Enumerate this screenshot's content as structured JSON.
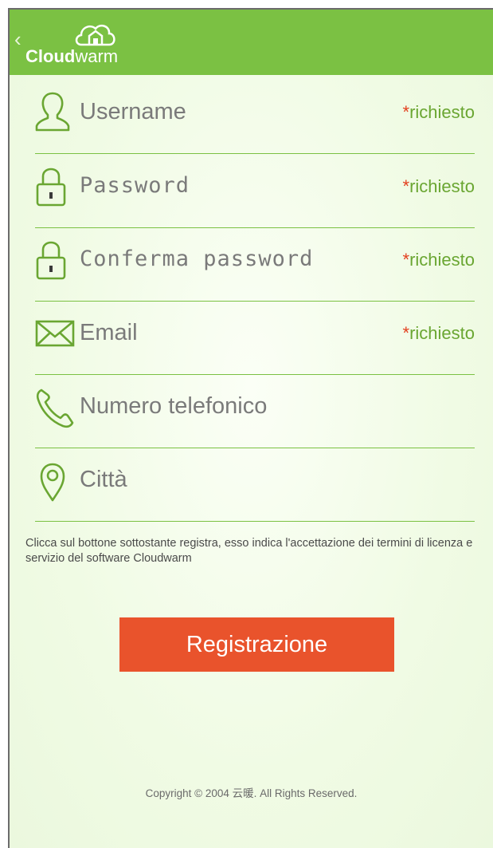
{
  "header": {
    "back_symbol": "‹",
    "logo_bold": "Cloud",
    "logo_light": "warm",
    "background": "#7bc143"
  },
  "form": {
    "fields": [
      {
        "icon": "user-icon",
        "label": "Username",
        "required": "richiesto",
        "required_star": "*"
      },
      {
        "icon": "lock-icon",
        "label": "Password",
        "required": "richiesto",
        "required_star": "*"
      },
      {
        "icon": "lock-icon",
        "label": "Conferma password",
        "required": "richiesto",
        "required_star": "*"
      },
      {
        "icon": "mail-icon",
        "label": "Email",
        "required": "richiesto",
        "required_star": "*"
      },
      {
        "icon": "phone-icon",
        "label": "Numero telefonico"
      },
      {
        "icon": "location-pin-icon",
        "label": "Città"
      }
    ]
  },
  "notice": "Clicca sul bottone sottostante registra, esso indica l'accettazione dei termini di licenza e servizio del software Cloudwarm",
  "register_button": {
    "label": "Registrazione",
    "color": "#e9532c"
  },
  "footer": {
    "copyright": "Copyright © 2004 云暖. All Rights Reserved."
  },
  "colors": {
    "accent": "#7bc143",
    "required_text": "#6aa632",
    "required_star": "#e33f1e"
  }
}
